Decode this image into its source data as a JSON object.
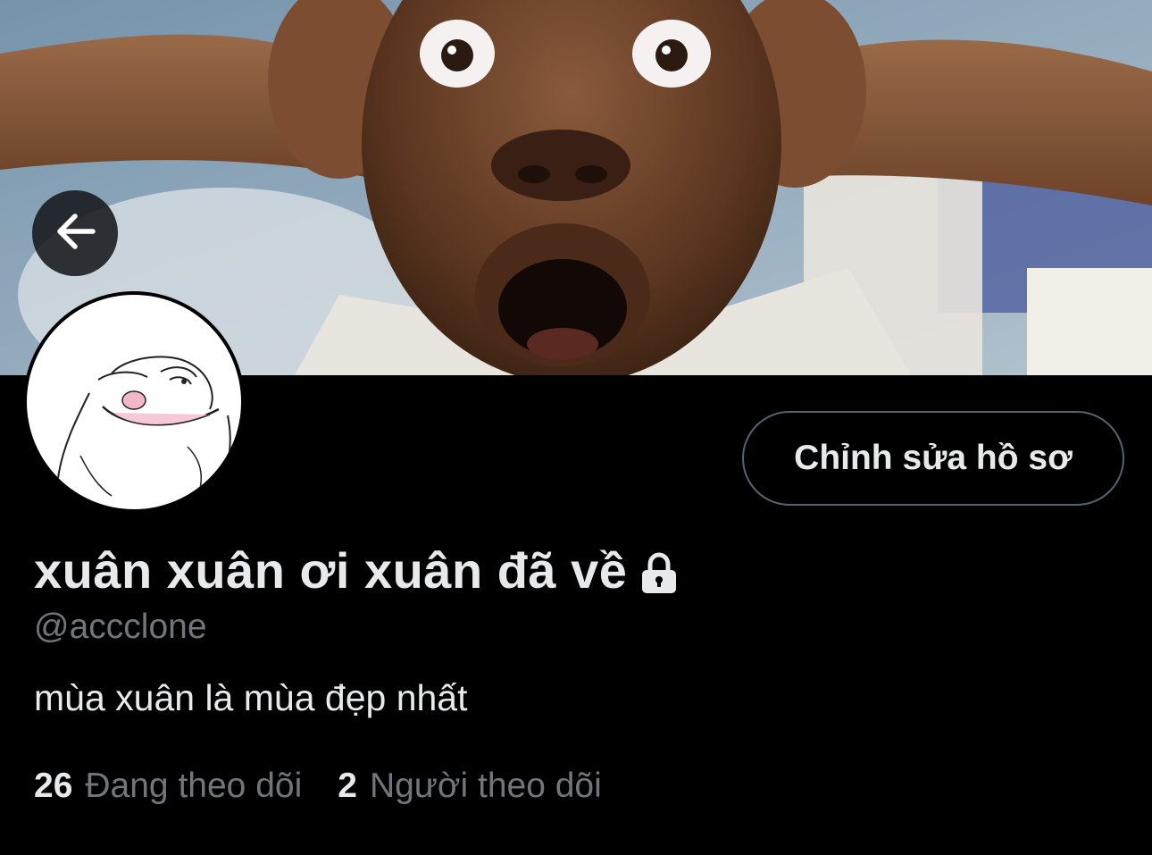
{
  "profile": {
    "display_name": "xuân xuân ơi xuân đã về",
    "handle": "@accclone",
    "bio": "mùa xuân là mùa đẹp nhất",
    "protected_icon": "lock-icon",
    "edit_profile_label": "Chỉnh sửa hồ sơ"
  },
  "stats": {
    "following_count": "26",
    "following_label": "Đang theo dõi",
    "followers_count": "2",
    "followers_label": "Người theo dõi"
  },
  "header": {
    "back_icon": "arrow-left-icon",
    "banner_image": "surprised-face-photo",
    "avatar_image": "smiling-cartoon-drawing"
  },
  "colors": {
    "background": "#000000",
    "primary_text": "#e7e9ea",
    "secondary_text": "#71767b",
    "button_border": "#536471"
  }
}
